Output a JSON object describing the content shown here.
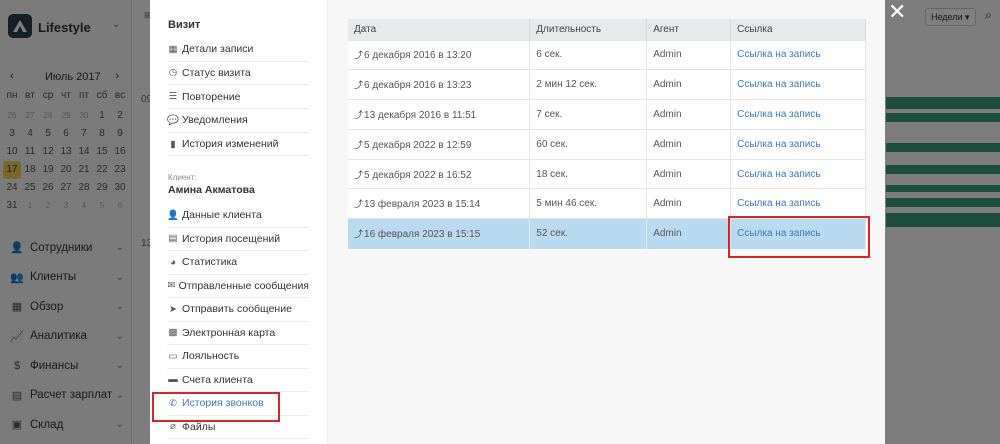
{
  "app": {
    "name": "Lifestyle"
  },
  "calendar": {
    "month": "Июль 2017",
    "weekdays": [
      "пн",
      "вт",
      "ср",
      "чт",
      "пт",
      "сб",
      "вс"
    ],
    "weeks": [
      [
        "26",
        "27",
        "28",
        "29",
        "30",
        "1",
        "2"
      ],
      [
        "3",
        "4",
        "5",
        "6",
        "7",
        "8",
        "9"
      ],
      [
        "10",
        "11",
        "12",
        "13",
        "14",
        "15",
        "16"
      ],
      [
        "17",
        "18",
        "19",
        "20",
        "21",
        "22",
        "23"
      ],
      [
        "24",
        "25",
        "26",
        "27",
        "28",
        "29",
        "30"
      ],
      [
        "31",
        "1",
        "2",
        "3",
        "4",
        "5",
        "6"
      ]
    ],
    "today": "17"
  },
  "sidebar": {
    "items": [
      {
        "label": "Сотрудники",
        "icon": "user-icon"
      },
      {
        "label": "Клиенты",
        "icon": "users-icon"
      },
      {
        "label": "Обзор",
        "icon": "grid-icon"
      },
      {
        "label": "Аналитика",
        "icon": "chart-icon"
      },
      {
        "label": "Финансы",
        "icon": "money-icon"
      },
      {
        "label": "Расчет зарплат",
        "icon": "calculator-icon"
      },
      {
        "label": "Склад",
        "icon": "box-icon"
      }
    ]
  },
  "background": {
    "times": [
      "09",
      "13"
    ],
    "view_select": "Недели"
  },
  "modal": {
    "visit_title": "Визит",
    "visit_items": [
      {
        "label": "Детали записи",
        "icon": "calendar-icon"
      },
      {
        "label": "Статус визита",
        "icon": "clock-icon"
      },
      {
        "label": "Повторение",
        "icon": "list-icon"
      },
      {
        "label": "Уведомления",
        "icon": "comments-icon"
      },
      {
        "label": "История изменений",
        "icon": "file-icon"
      }
    ],
    "client_caption": "Клиент:",
    "client_name": "Амина Акматова",
    "client_items": [
      {
        "label": "Данные клиента",
        "icon": "user-icon"
      },
      {
        "label": "История посещений",
        "icon": "list-box-icon"
      },
      {
        "label": "Статистика",
        "icon": "pie-chart-icon"
      },
      {
        "label": "Отправленные сообщения",
        "icon": "envelope-icon"
      },
      {
        "label": "Отправить сообщение",
        "icon": "paper-plane-icon"
      },
      {
        "label": "Электронная карта",
        "icon": "qr-icon"
      },
      {
        "label": "Лояльность",
        "icon": "card-icon"
      },
      {
        "label": "Счета клиента",
        "icon": "invoice-icon"
      },
      {
        "label": "История звонков",
        "icon": "phone-icon",
        "active": true
      },
      {
        "label": "Файлы",
        "icon": "paperclip-icon"
      }
    ]
  },
  "calls_table": {
    "columns": [
      "Дата",
      "Длительность",
      "Агент",
      "Ссылка"
    ],
    "rows": [
      {
        "date": "6 декабря 2016 в 13:20",
        "duration": "6 сек.",
        "agent": "Admin",
        "link": "Ссылка на запись"
      },
      {
        "date": "6 декабря 2016 в 13:23",
        "duration": "2 мин 12 сек.",
        "agent": "Admin",
        "link": "Ссылка на запись"
      },
      {
        "date": "13 декабря 2016 в 11:51",
        "duration": "7 сек.",
        "agent": "Admin",
        "link": "Ссылка на запись"
      },
      {
        "date": "5 декабря 2022  в 12:59",
        "duration": "60 сек.",
        "agent": "Admin",
        "link": "Ссылка на запись"
      },
      {
        "date": "5 декабря 2022  в 16:52",
        "duration": "18 сек.",
        "agent": "Admin",
        "link": "Ссылка на запись"
      },
      {
        "date": "13 февраля 2023 в 15:14",
        "duration": "5 мин 46 сек.",
        "agent": "Admin",
        "link": "Ссылка на запись"
      },
      {
        "date": "16 февраля 2023 в 15:15",
        "duration": "52 сек.",
        "agent": "Admin",
        "link": "Ссылка на запись",
        "selected": true
      }
    ]
  },
  "colors": {
    "highlight": "#d9242b",
    "selected_row": "#b9daef",
    "link": "#3d78b8",
    "today": "#f0d34a"
  }
}
